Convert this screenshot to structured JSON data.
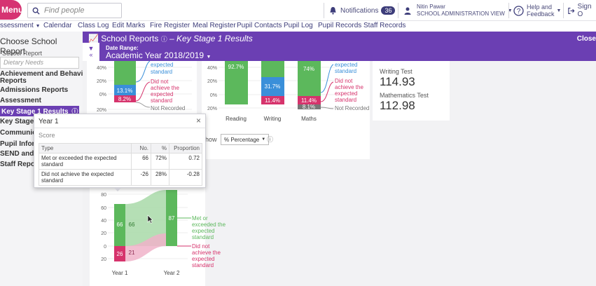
{
  "topbar": {
    "menu_label": "Menu",
    "search_placeholder": "Find people",
    "notifications_label": "Notifications",
    "notifications_count": "36",
    "user_name": "Nitin Pawar",
    "user_role": "SCHOOL ADMINISTRATION VIEW",
    "help_label_1": "Help and",
    "help_label_2": "Feedback",
    "signout_label": "Sign O"
  },
  "nav": {
    "items": [
      "ssessment",
      "Calendar",
      "Class Log",
      "Edit Marks",
      "Fire Register",
      "Meal Register",
      "Pupil Contacts",
      "Pupil Log",
      "Pupil Records",
      "Staff Records"
    ]
  },
  "sidebar": {
    "title": "Choose School Report",
    "label": "School Report",
    "search_placeholder": "Dietary Needs",
    "items": [
      "Achievement and Behaviour",
      "Reports",
      "Admissions Reports",
      "Assessment",
      "Key Stage 1 Results",
      "Key Stage 2 R",
      "Communicat",
      "Pupil Informa",
      "SEND and Vu",
      "Staff Reports"
    ]
  },
  "header": {
    "title": "School Reports",
    "subtitle": "– Key Stage 1 Results",
    "close_label": "Close",
    "date_range_label": "Date Range:",
    "date_range_value": "Academic Year 2018/2019"
  },
  "top_left_chart": {
    "tick_labels": [
      "40%",
      "20%",
      "0%",
      "20%"
    ],
    "bars": {
      "blue": "13.1%",
      "pink": "8.2%"
    },
    "legend": [
      "expected",
      "standard",
      "Did not",
      "achieve the",
      "expected",
      "standard",
      "Not Recorded"
    ]
  },
  "subject_chart": {
    "tick_labels": [
      "40%",
      "20%",
      "0%",
      "20%"
    ],
    "categories": [
      "Reading",
      "Writing",
      "Maths"
    ],
    "green": [
      "92.7%",
      "",
      "74%"
    ],
    "blue": [
      "",
      "31.7%",
      ""
    ],
    "pink": [
      "",
      "11.4%",
      "11.4%"
    ],
    "grey": [
      "",
      "",
      "8.1%"
    ],
    "legend": [
      "expected",
      "standard",
      "Did not",
      "achieve the",
      "expected",
      "standard",
      "Not Recorded"
    ]
  },
  "scores": {
    "writing_label": "Writing Test",
    "writing_value": "114.93",
    "maths_label": "Mathematics Test",
    "maths_value": "112.98"
  },
  "show_control": {
    "label": "how",
    "value": "% Percentage"
  },
  "bottom_chart": {
    "tick_labels": [
      "80",
      "60",
      "40",
      "20",
      "0",
      "20"
    ],
    "categories": [
      "Year 1",
      "Year 2"
    ],
    "y1_green": "66",
    "y1_green_flow": "66",
    "y1_pink": "26",
    "y1_pink_flow": "21",
    "y2_green": "87",
    "y2_pink": "",
    "legend_met": [
      "Met or",
      "exceeded the",
      "expected",
      "standard"
    ],
    "legend_not": [
      "Did not",
      "achieve the",
      "expected",
      "standard"
    ]
  },
  "popup": {
    "title": "Year 1",
    "close": "×",
    "subtitle": "Score",
    "headers": [
      "Type",
      "No.",
      "%",
      "Proportion"
    ],
    "rows": [
      {
        "type": "Met or exceeded the expected standard",
        "no": "66",
        "pct": "72%",
        "prop": "0.72"
      },
      {
        "type": "Did not achieve the expected standard",
        "no": "-26",
        "pct": "28%",
        "prop": "-0.28"
      }
    ]
  },
  "colors": {
    "green": "#5cb85c",
    "blue": "#3a8fd9",
    "pink": "#d6336c",
    "grey": "#777777",
    "purple": "#6b3fb3",
    "menu": "#d63372"
  }
}
